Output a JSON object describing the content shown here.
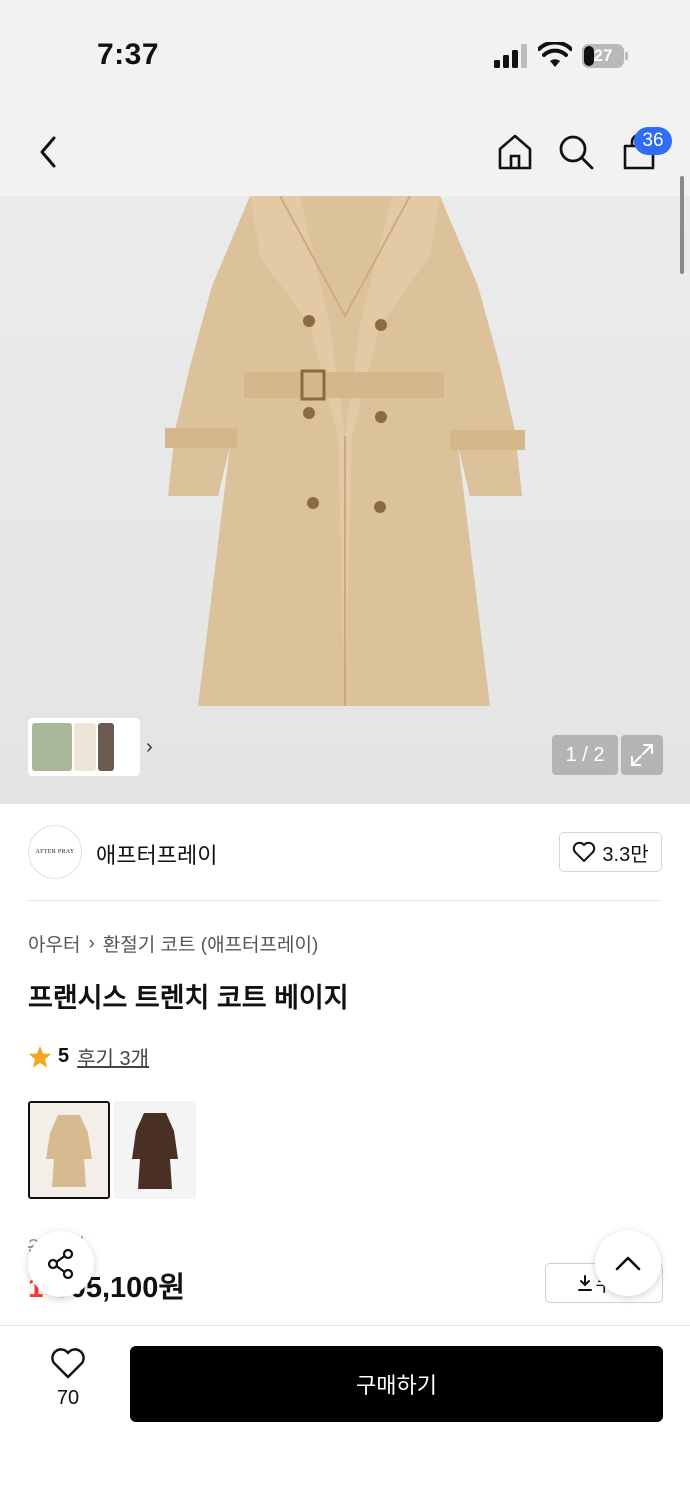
{
  "status_bar": {
    "time": "7:37",
    "battery": "27"
  },
  "nav": {
    "back_icon": "chevron-left-icon",
    "home_icon": "home-icon",
    "search_icon": "search-icon",
    "cart_icon": "shopping-bag-icon",
    "cart_count": "36"
  },
  "gallery": {
    "counter": "1 / 2",
    "expand_icon": "expand-icon"
  },
  "brand": {
    "logo_text": "AFTER PRAY",
    "name": "애프터프레이",
    "likes": "3.3만"
  },
  "breadcrumb": {
    "category": "아우터",
    "subcategory": "환절기 코트 (애프터프레이)"
  },
  "product": {
    "title": "프랜시스 트렌치 코트 베이지",
    "rating": "5",
    "reviews": "후기 3개",
    "colors": [
      {
        "name": "beige",
        "hex": "#d6bb91"
      },
      {
        "name": "brown",
        "hex": "#4a3024"
      }
    ]
  },
  "price": {
    "original": "3 00원",
    "discount": "1",
    "final": "305,100원",
    "coupon_label": "쿠폰"
  },
  "bottom": {
    "wish_count": "70",
    "buy_label": "구매하기"
  },
  "colors": {
    "accent_blue": "#2f6df6",
    "sale_red": "#ff3b30",
    "star": "#f5a623"
  }
}
